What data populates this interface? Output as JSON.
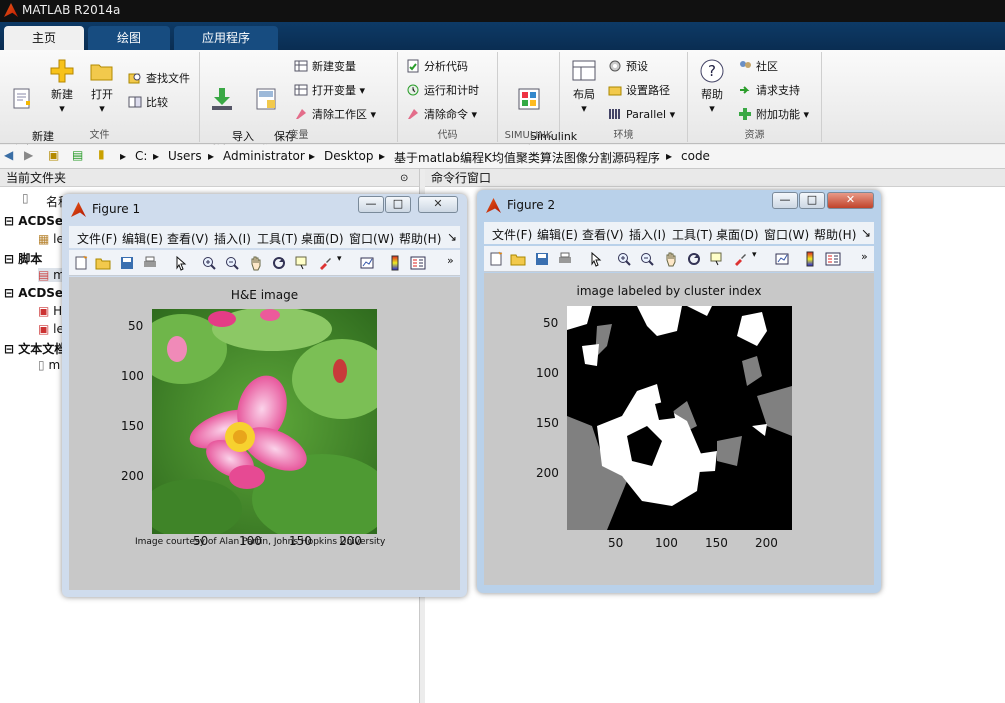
{
  "app": {
    "title": "MATLAB R2014a"
  },
  "tabs": [
    {
      "label": "主页"
    },
    {
      "label": "绘图"
    },
    {
      "label": "应用程序"
    }
  ],
  "ribbon": {
    "file": {
      "label": "文件",
      "new_script": "新建\n脚本",
      "new": "新建",
      "open": "打开",
      "find_files": "查找文件",
      "compare": "比较"
    },
    "variable": {
      "label": "变量",
      "import": "导入\n数据",
      "save_ws": "保存\n工作区",
      "new_var": "新建变量",
      "open_var": "打开变量",
      "clear_ws": "清除工作区"
    },
    "code": {
      "label": "代码",
      "analyze": "分析代码",
      "run_time": "运行和计时",
      "clear_cmd": "清除命令"
    },
    "simulink": {
      "label": "SIMULINK",
      "lib": "Simulink\n库"
    },
    "env": {
      "label": "环境",
      "layout": "布局",
      "prefs": "预设",
      "set_path": "设置路径",
      "parallel": "Parallel"
    },
    "resources": {
      "label": "资源",
      "help": "帮助",
      "community": "社区",
      "support": "请求支持",
      "addons": "附加功能"
    }
  },
  "address": {
    "crumbs": [
      "C:",
      "Users",
      "Administrator",
      "Desktop",
      "基于matlab编程K均值聚类算法图像分割源码程序",
      "code"
    ]
  },
  "left_panel": {
    "title": "当前文件夹",
    "name_col": "名称",
    "tree": [
      {
        "label": "ACDSee"
      },
      {
        "label": "le"
      },
      {
        "label": "脚本"
      },
      {
        "label": "m"
      },
      {
        "label": "ACDSee"
      },
      {
        "label": "H"
      },
      {
        "label": "le"
      },
      {
        "label": "文本文档"
      },
      {
        "label": "m"
      }
    ]
  },
  "right_panel": {
    "title": "命令行窗口"
  },
  "menu_items": [
    "文件(F)",
    "编辑(E)",
    "查看(V)",
    "插入(I)",
    "工具(T)",
    "桌面(D)",
    "窗口(W)",
    "帮助(H)"
  ],
  "figure1": {
    "title": "Figure 1",
    "axes_title": "H&E image",
    "yticks": [
      "50",
      "100",
      "150",
      "200"
    ],
    "xticks": [
      "50",
      "100",
      "150",
      "200"
    ],
    "note": "Image courtesy of Alan Partin, Johns Hopkins University"
  },
  "figure2": {
    "title": "Figure 2",
    "axes_title": "image labeled by cluster index",
    "yticks": [
      "50",
      "100",
      "150",
      "200"
    ],
    "xticks": [
      "50",
      "100",
      "150",
      "200"
    ]
  },
  "colors": {
    "ribbon_tab_bg": "#0d3a66",
    "figure_frame": "#cfdced"
  }
}
